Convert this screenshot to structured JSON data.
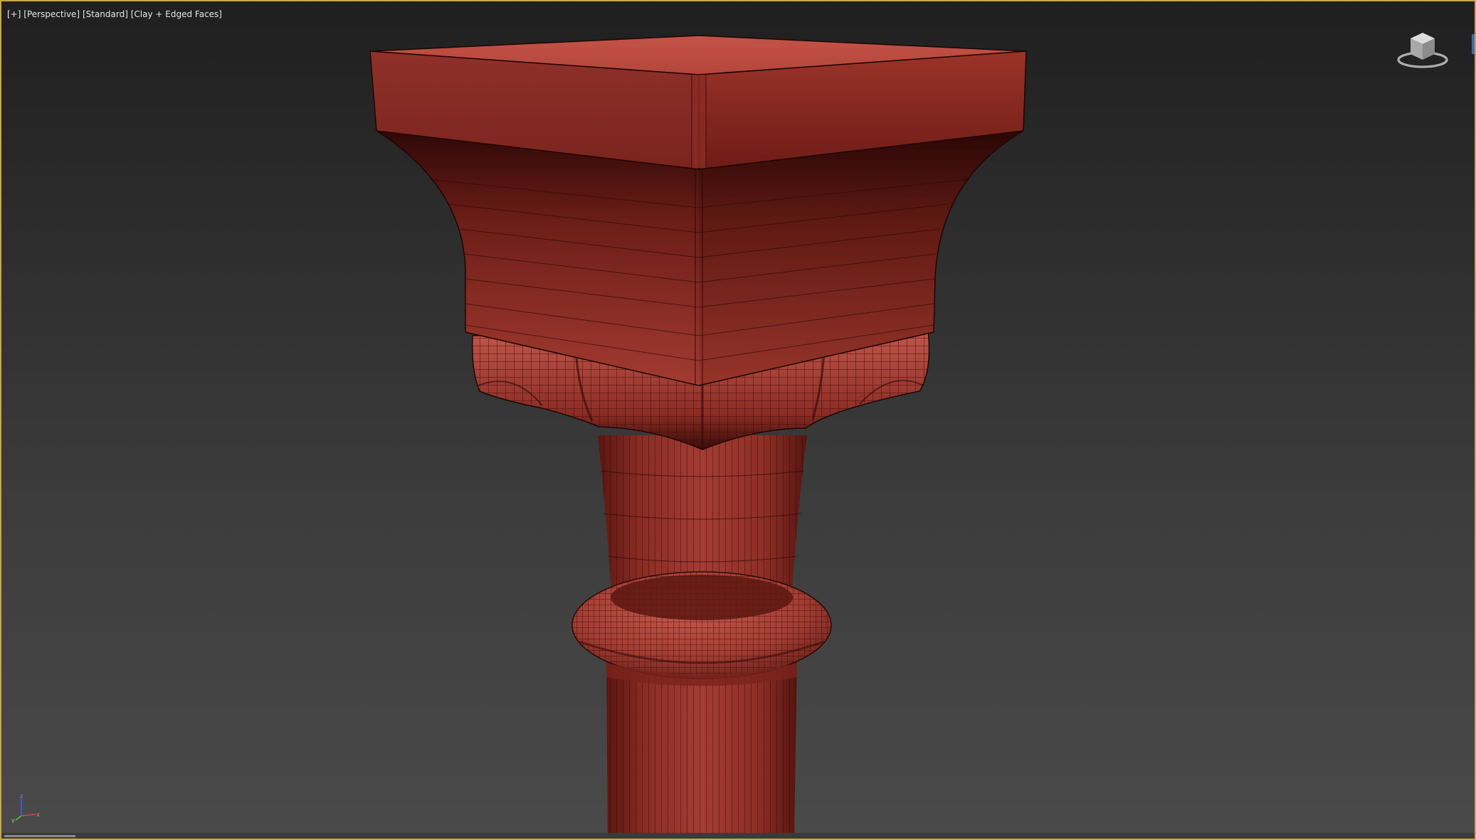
{
  "viewport": {
    "label_plus": "[+]",
    "label_view": "[Perspective]",
    "label_shading_preset": "[Standard]",
    "label_shading_mode": "[Clay + Edged Faces]"
  },
  "viewcube": {
    "icon": "viewcube-icon"
  },
  "axis_tripod": {
    "x_label": "x",
    "y_label": "y",
    "z_label": "z"
  },
  "colors": {
    "frame_border": "#c9a64a",
    "clay": "#a8423a",
    "clay_dark": "#5a1410",
    "wire": "#2a0806"
  }
}
